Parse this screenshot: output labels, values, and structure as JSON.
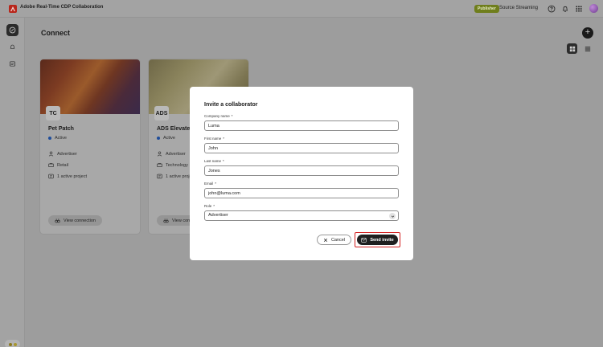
{
  "app": {
    "title": "Adobe Real-Time CDP Collaboration",
    "publisher_badge": "Publisher",
    "source_label": "Source Streaming",
    "accent_color": "#d21d1d"
  },
  "page": {
    "title": "Connect",
    "add_label": "+"
  },
  "cards": [
    {
      "name": "Pet Patch",
      "status": "Active",
      "role": "Advertiser",
      "industry": "Retail",
      "projects": "1 active project",
      "button": "View connection",
      "logo_text": "TC"
    },
    {
      "name": "ADS Elevate",
      "status": "Active",
      "role": "Advertiser",
      "industry": "Technology",
      "projects": "1 active proje",
      "button": "View con",
      "logo_text": "ADS"
    }
  ],
  "modal": {
    "title": "Invite a collaborator",
    "required_mark": "*",
    "fields": {
      "company": {
        "label": "Company name",
        "value": "Luma"
      },
      "first": {
        "label": "First name",
        "value": "John"
      },
      "last": {
        "label": "Last name",
        "value": "Jones"
      },
      "email": {
        "label": "Email",
        "value": "john@luma.com"
      },
      "role": {
        "label": "Role",
        "value": "Advertiser"
      }
    },
    "cancel_label": "Cancel",
    "send_label": "Send invite"
  }
}
